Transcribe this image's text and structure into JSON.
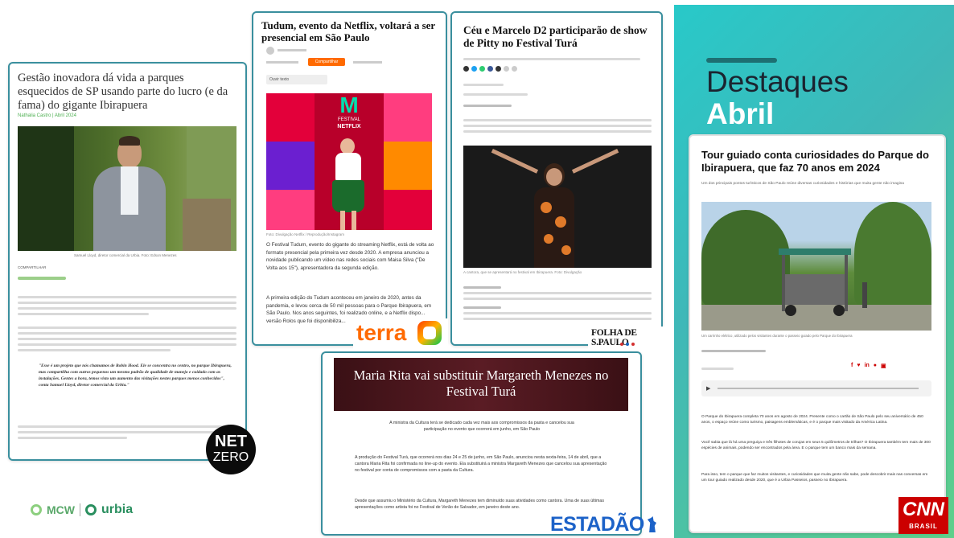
{
  "panel": {
    "heading_1": "Destaques",
    "heading_2": "Abril"
  },
  "articles": {
    "netzero": {
      "title": "Gestão inovadora dá vida a parques esquecidos de SP usando parte do lucro (e da fama) do gigante Ibirapuera",
      "meta": "Nathalia Castro | Abril 2024",
      "caption": "Samuel Lloyd, diretor comercial da Urbia. Foto: Edson Menezes",
      "share_label": "COMPARTILHAR",
      "quote": "\"Esse é um projeto que nós chamamos de Robin Hood. Ele se concentra no centro, no parque Ibirapuera, mas compartilha com outros pequenos um mesmo padrão de qualidade de manejo e cuidado com as instalações. Gentes a hora, temos visto um aumento das visitações nestes parques menos conhecidos\", conta Samuel Lloyd, diretor comercial da Urbia.\""
    },
    "terra": {
      "title": "Tudum, evento da Netflix, voltará a ser presencial em São Paulo",
      "share_button": "Compartilhar",
      "listen_label": "Ouvir texto",
      "caption": "Foto: Divulgação Netflix / Reprodução/Instagram",
      "body_1": "O Festival Tudum, evento do gigante do streaming Netflix, está de volta ao formato presencial pela primeira vez desde 2020. A empresa anunciou a novidade publicando um vídeo nas redes sociais com Maisa Silva (\"De Volta aos 15\"), apresentadora da segunda edição.",
      "body_2": "A primeira edição do Tudum aconteceu em janeiro de 2020, antes da pandemia, e levou cerca de 50 mil pessoas para o Parque Ibirapuera, em São Paulo. Nos anos seguintes, foi realizado online, e a Netflix dispo... versão Rolos que foi disponibiliza..."
    },
    "folha": {
      "title": "Céu e Marcelo D2 participarão de show de Pitty no Festival Turá",
      "caption": "A cantora, que se apresentará no festival em Ibirapuera. Foto: Divulgação"
    },
    "estadao": {
      "title": "Maria Rita vai substituir Margareth Menezes no Festival Turá",
      "lead": "A ministra da Cultura terá se dedicado cada vez mais aos compromissos da pasta e cancelou sua participação no evento que ocorrerá em junho, em São Paulo",
      "body_1": "A produção do Festival Turá, que ocorrerá nos dias 24 e 25 de junho, em São Paulo, anunciou nesta sexta-feira, 14 de abril, que a cantora Maria Rita foi confirmada no line-up do evento. Ela substituirá a ministra Margareth Menezes que cancelou sua apresentação no festival por conta de compromissos com a pasta da Cultura.",
      "body_2": "Desde que assumiu o Ministério da Cultura, Margareth Menezes tem diminuído suas atividades como cantora. Uma de suas últimas apresentações como artista foi no Festival de Verão de Salvador, em janeiro deste ano."
    },
    "cnn": {
      "title": "Tour guiado conta curiosidades do Parque do Ibirapuera, que faz 70 anos em 2024",
      "subtitle": "Um dos principais pontos turísticos de São Paulo reúne diversas curiosidades e histórias que muita gente não imagina",
      "caption": "Um carrinho elétrico, utilizado pelos visitantes durante o passeio guiado pelo Parque do Ibirapuera",
      "body_1": "O Parque do Ibirapuera completa 70 anos em agosto de 2024. Presente como o cartão de São Paulo pelo seu aniversário de 450 anos, o espaço reúne como turismo, paisagens emblemáticas, e é o parque mais visitado da América Latina.",
      "body_2": "Você sabia que lá há uma preguiça e três filhotes de corujas em seus 5 quilômetros de trilhas? O Ibirapuera também tem mais de 300 espécies de animais, podendo ser encontrados pela área. E o parque tem um banco mais da semana.",
      "body_3": "Para isso, tem o parque que faz muitos visitantes, e curiosidades que muita gente não sabe, pode descobrir mais nas conversas em um tour guiado realizado desde 2020, que é a Urbia Passeios, passeio no Ibirapuera."
    }
  },
  "logos": {
    "terra": "terra",
    "folha": "FOLHA DE S.PAULO",
    "estadao": "ESTADÃO",
    "cnn_top": "CNN",
    "cnn_bottom": "BRASIL",
    "netzero_top": "NET",
    "netzero_bottom": "ZERO",
    "mcw": "MCW",
    "urbia": "urbia",
    "netflix_festival": "FESTIVAL",
    "netflix_name": "NETFLIX"
  },
  "colors": {
    "teal_border": "#3a8f9e",
    "terra_orange": "#ff6a00",
    "cnn_red": "#cc0000",
    "estadao_blue": "#1c62c8",
    "urbia_green": "#2a8f5f"
  }
}
